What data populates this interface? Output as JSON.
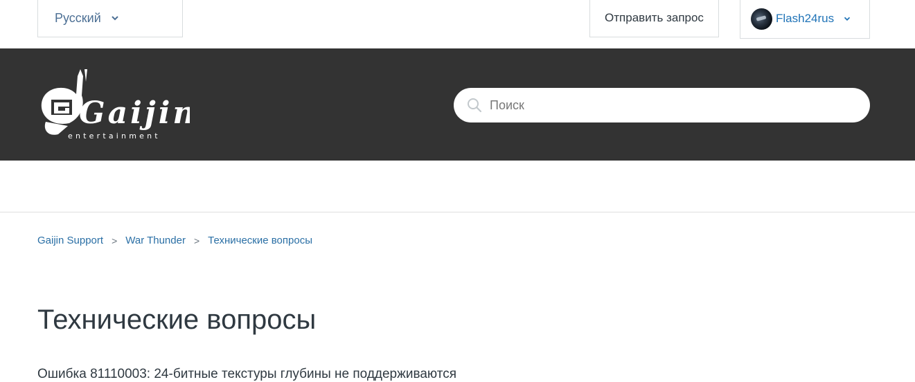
{
  "topbar": {
    "language": "Русский",
    "submit_request": "Отправить запрос",
    "user_name": "Flash24rus"
  },
  "header": {
    "logo_text": "Gaijin",
    "logo_subtext": "entertainment",
    "search_placeholder": "Поиск"
  },
  "breadcrumbs": [
    {
      "label": "Gaijin Support"
    },
    {
      "label": "War Thunder"
    },
    {
      "label": "Технические вопросы"
    }
  ],
  "breadcrumb_separator": ">",
  "page": {
    "title": "Технические вопросы",
    "articles": [
      {
        "title": "Ошибка 81110003: 24-битные текстуры глубины не поддерживаются"
      }
    ]
  },
  "colors": {
    "header_bg": "#333333",
    "link": "#1f73b7",
    "text": "#2f3941"
  },
  "icons": {
    "search": "search-icon",
    "chevron": "chevron-down-icon"
  }
}
